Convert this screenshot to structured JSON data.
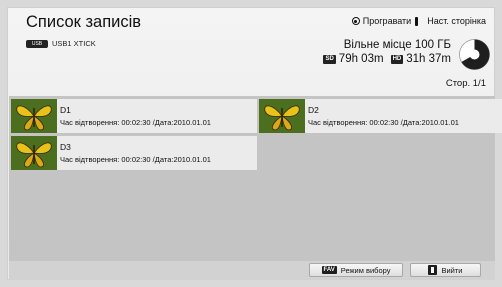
{
  "header": {
    "title": "Список записів",
    "device_label": "USB1 XTICK",
    "play_label": "Програвати",
    "next_page_label": "Наст. сторінка",
    "free_space_label": "Вільне місце 100 ГБ",
    "sd_badge": "SD",
    "sd_time": "79h 03m",
    "hd_badge": "HD",
    "hd_time": "31h 37m",
    "page_label": "Стор. 1/1"
  },
  "recordings": [
    {
      "name": "D1",
      "meta": "Час відтворення: 00:02:30 /Дата:2010.01.01"
    },
    {
      "name": "D2",
      "meta": "Час відтворення: 00:02:30 /Дата:2010.01.01"
    },
    {
      "name": "D3",
      "meta": "Час відтворення: 00:02:30 /Дата:2010.01.01"
    }
  ],
  "footer": {
    "fav_badge": "FAV",
    "select_mode_label": "Режим вибору",
    "exit_label": "Вийти"
  },
  "colors": {
    "accent_disk": "#1e1e1e",
    "list_background": "#c4c4c4",
    "thumbnail_bg": "#3b5e1a",
    "butterfly": "#e8c21a"
  }
}
